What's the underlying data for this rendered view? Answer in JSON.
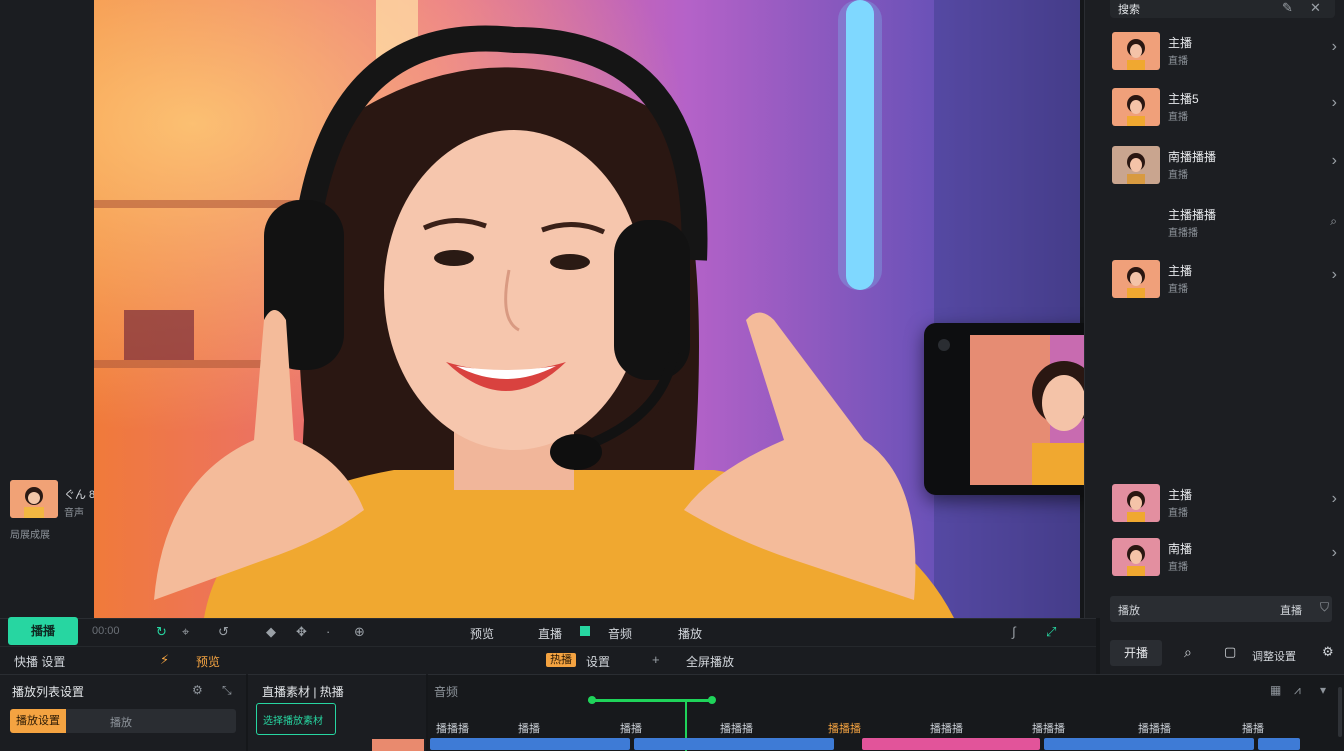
{
  "left_panel": {
    "thumb_caption": "ぐん 8",
    "thumb_sub": "音声",
    "thumb_sub2": "局展成展"
  },
  "right_panel": {
    "header_label": "搜索",
    "items": [
      {
        "title": "主播",
        "sub": "直播"
      },
      {
        "title": "主播5",
        "sub": "直播"
      },
      {
        "title": "南播播播",
        "sub": "直播"
      },
      {
        "title": "主播播播",
        "sub": "直播播"
      },
      {
        "title": "主播",
        "sub": "直播"
      },
      {
        "title": "",
        "sub": ""
      },
      {
        "title": "",
        "sub": ""
      },
      {
        "title": "",
        "sub": ""
      },
      {
        "title": "主播",
        "sub": "直播"
      },
      {
        "title": "南播",
        "sub": "直播"
      }
    ],
    "search_bar": {
      "left": "播放",
      "right": "直播"
    },
    "bottom_buttons": {
      "left": "开播",
      "right": "调整设置"
    }
  },
  "toolbar1": {
    "primary": "播播",
    "time": "00:00",
    "center_labels": [
      "预览",
      "直播",
      "音频",
      "播放"
    ]
  },
  "toolbar2": {
    "left_label": "快播 设置",
    "mid_label": "预览",
    "orange_tag": "热播",
    "mid2": "设置",
    "right_label": "全屏播放"
  },
  "bottom_left": {
    "title": "播放列表设置",
    "input_value": "播放设置",
    "input_hint": "播放"
  },
  "bottom_mid": {
    "title": "直播素材 | 热播",
    "active": "选择播放素材"
  },
  "timeline": {
    "title": "音频",
    "ruler": [
      "播播播",
      "播播",
      "播播",
      "播播播",
      "播播播",
      "播播播",
      "播播播",
      "播播播",
      "播播"
    ],
    "highlight_index": 4,
    "colors": {
      "accent": "#27d6a1",
      "orange": "#f4a341",
      "track_blue": "#3e7bd6",
      "track_pink": "#e2549a"
    }
  }
}
